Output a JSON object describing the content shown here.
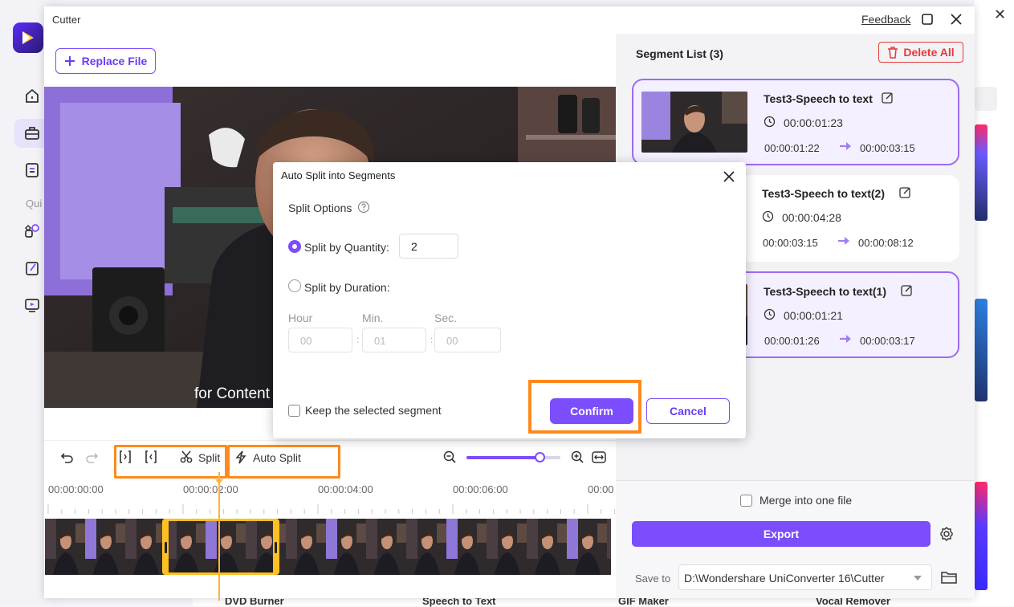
{
  "window": {
    "title": "Cutter",
    "feedback_label": "Feedback"
  },
  "left": {
    "replace_file_label": "Replace File",
    "subtitle_text": "for Content"
  },
  "toolbar": {
    "split_label": "Split",
    "auto_split_label": "Auto Split",
    "zoom_level_fraction": 0.78
  },
  "timeline": {
    "time_labels": [
      "00:00:00:00",
      "00:00:02:00",
      "00:00:04:00",
      "00:00:06:00",
      "00:00"
    ]
  },
  "segments": {
    "title": "Segment List (3)",
    "delete_all_label": "Delete All",
    "items": [
      {
        "name": "Test3-Speech to text",
        "duration": "00:00:01:23",
        "start": "00:00:01:22",
        "end": "00:00:03:15",
        "selected": true
      },
      {
        "name": "Test3-Speech to text(2)",
        "duration": "00:00:04:28",
        "start": "00:00:03:15",
        "end": "00:00:08:12",
        "selected": false
      },
      {
        "name": "Test3-Speech to text(1)",
        "duration": "00:00:01:21",
        "start": "00:00:01:26",
        "end": "00:00:03:17",
        "selected": true
      }
    ]
  },
  "export": {
    "merge_label": "Merge into one file",
    "export_label": "Export",
    "save_to_label": "Save to",
    "save_path": "D:\\Wondershare UniConverter 16\\Cutter"
  },
  "modal": {
    "title": "Auto Split into Segments",
    "split_options_label": "Split Options",
    "by_quantity_label": "Split by Quantity:",
    "quantity_value": "2",
    "by_duration_label": "Split by Duration:",
    "hour_label": "Hour",
    "min_label": "Min.",
    "sec_label": "Sec.",
    "hour_value": "00",
    "min_value": "01",
    "sec_value": "00",
    "keep_label": "Keep the selected segment",
    "confirm_label": "Confirm",
    "cancel_label": "Cancel"
  },
  "background": {
    "quick_label": "Qui",
    "bottom_labels": [
      "DVD Burner",
      "Speech to Text",
      "GIF Maker",
      "Vocal Remover"
    ]
  },
  "colors": {
    "accent": "#7b4dfc",
    "highlight": "#ff8a1c",
    "delete": "#e43a3a",
    "selection": "#ffc022"
  },
  "icons": [
    "app-logo-icon",
    "home-icon",
    "toolbox-icon",
    "document-icon",
    "ai-tools-icon",
    "edit-icon",
    "screen-icon",
    "plus-icon",
    "maximize-icon",
    "close-icon",
    "undo-icon",
    "redo-icon",
    "set-in-icon",
    "set-out-icon",
    "scissors-icon",
    "lightning-icon",
    "zoom-out-icon",
    "zoom-in-icon",
    "fit-icon",
    "trash-icon",
    "clock-icon",
    "arrow-right-icon",
    "settings-icon",
    "folder-icon",
    "help-icon",
    "chevron-down-icon"
  ]
}
